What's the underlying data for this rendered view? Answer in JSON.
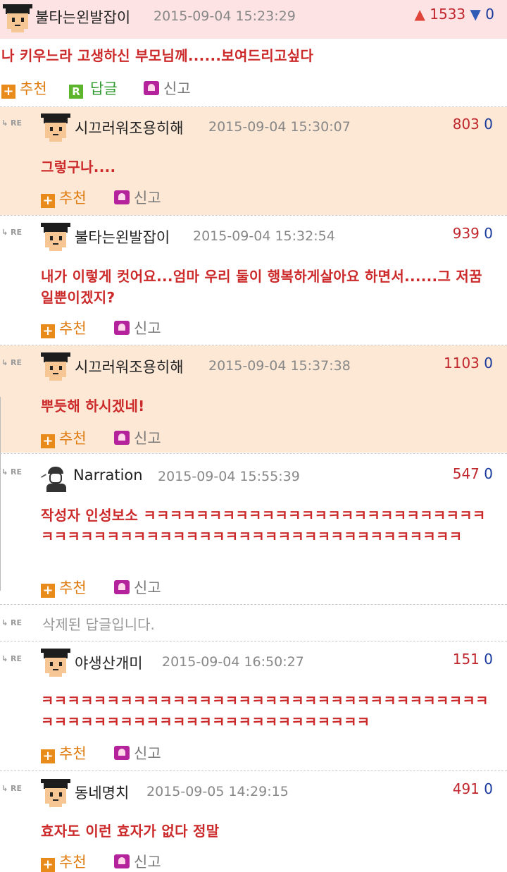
{
  "colors": {
    "top_bg": "#fde3e4",
    "reply_bg": "#fce8d5",
    "upvote": "#c0272d",
    "downvote": "#1a3a9c",
    "comment_text": "#cc2a2a",
    "recommend": "#e07d12",
    "reply": "#2f9b2f"
  },
  "labels": {
    "re": "RE",
    "recommend": "추천",
    "reply": "답글",
    "report": "신고",
    "plus_icon": "+",
    "reply_icon": "R"
  },
  "top": {
    "nick": "불타는왼발잡이",
    "date": "2015-09-04 15:23:29",
    "up": "1533",
    "down": "0",
    "text": "나 키우느라 고생하신 부모님께......보여드리고싶다"
  },
  "comments": [
    {
      "nick": "시끄러워조용히해",
      "date": "2015-09-04 15:30:07",
      "up": "803",
      "down": "0",
      "text": "그렇구나....",
      "avatar": "pixel-avatar"
    },
    {
      "nick": "불타는왼발잡이",
      "date": "2015-09-04 15:32:54",
      "up": "939",
      "down": "0",
      "text": "내가 이렇게 컷어요...엄마 우리 둘이 행복하게살아요 하면서......그 저꿈일뿐이겠지?",
      "avatar": "pixel-avatar"
    },
    {
      "nick": "시끄러워조용히해",
      "date": "2015-09-04 15:37:38",
      "up": "1103",
      "down": "0",
      "text": "뿌듯해 하시겠네!",
      "avatar": "pixel-avatar"
    },
    {
      "nick": "Narration",
      "date": "2015-09-04 15:55:39",
      "up": "547",
      "down": "0",
      "text": "작성자 인성보소 ㅋㅋㅋㅋㅋㅋㅋㅋㅋㅋㅋㅋㅋㅋㅋㅋㅋㅋㅋㅋㅋㅋㅋㅋㅋㅋㅋㅋㅋㅋㅋㅋㅋㅋㅋㅋㅋㅋㅋㅋㅋㅋㅋㅋㅋㅋㅋㅋㅋㅋㅋㅋㅋㅋㅋㅋㅋㅋ",
      "avatar": "narration-avatar"
    },
    {
      "deleted": "삭제된 답글입니다."
    },
    {
      "nick": "야생산개미",
      "date": "2015-09-04 16:50:27",
      "up": "151",
      "down": "0",
      "text": "ㅋㅋㅋㅋㅋㅋㅋㅋㅋㅋㅋㅋㅋㅋㅋㅋㅋㅋㅋㅋㅋㅋㅋㅋㅋㅋㅋㅋㅋㅋㅋㅋㅋㅋㅋㅋㅋㅋㅋㅋㅋㅋㅋㅋㅋㅋㅋㅋㅋㅋㅋㅋㅋㅋㅋㅋㅋㅋㅋ",
      "avatar": "pixel-avatar"
    },
    {
      "nick": "동네명치",
      "date": "2015-09-05 14:29:15",
      "up": "491",
      "down": "0",
      "text": "효자도 이런 효자가 없다 정말",
      "avatar": "pixel-avatar"
    }
  ]
}
